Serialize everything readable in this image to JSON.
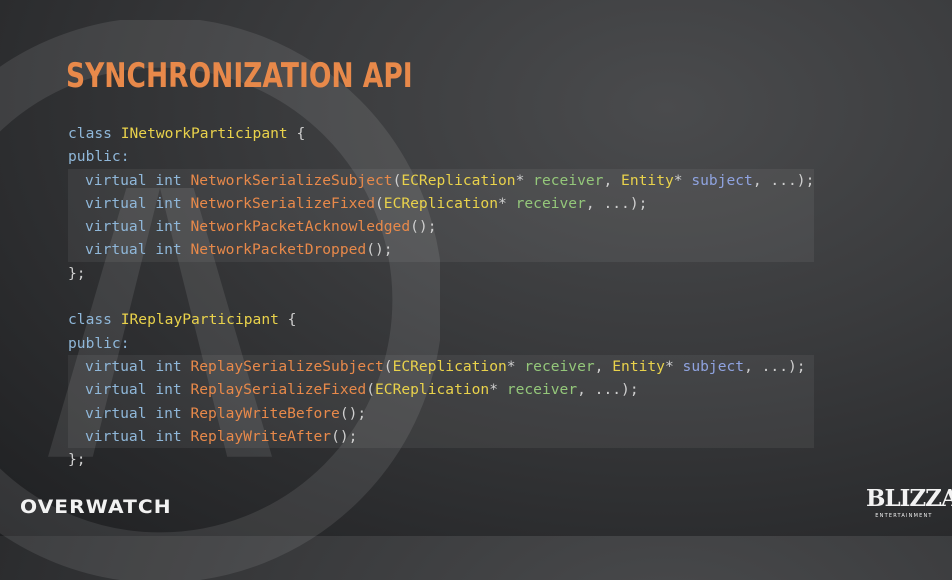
{
  "title": "SYNCHRONIZATION API",
  "code": {
    "network": {
      "class_kw": "class",
      "class_name": "INetworkParticipant",
      "open_brace": " {",
      "public": "public:",
      "lines": [
        {
          "kw": "virtual",
          "type": "int",
          "fn": "NetworkSerializeSubject",
          "a1": "ECReplication",
          "p1": "receiver",
          "a2": "Entity",
          "p2": "subject"
        },
        {
          "kw": "virtual",
          "type": "int",
          "fn": "NetworkSerializeFixed",
          "a1": "ECReplication",
          "p1": "receiver"
        },
        {
          "kw": "virtual",
          "type": "int",
          "fn": "NetworkPacketAcknowledged"
        },
        {
          "kw": "virtual",
          "type": "int",
          "fn": "NetworkPacketDropped"
        }
      ],
      "close": "};"
    },
    "replay": {
      "class_kw": "class",
      "class_name": "IReplayParticipant",
      "open_brace": " {",
      "public": "public:",
      "lines": [
        {
          "kw": "virtual",
          "type": "int",
          "fn": "ReplaySerializeSubject",
          "a1": "ECReplication",
          "p1": "receiver",
          "a2": "Entity",
          "p2": "subject"
        },
        {
          "kw": "virtual",
          "type": "int",
          "fn": "ReplaySerializeFixed",
          "a1": "ECReplication",
          "p1": "receiver"
        },
        {
          "kw": "virtual",
          "type": "int",
          "fn": "ReplayWriteBefore"
        },
        {
          "kw": "virtual",
          "type": "int",
          "fn": "ReplayWriteAfter"
        }
      ],
      "close": "};"
    }
  },
  "footer": {
    "overwatch_logo": "OVERWATCH",
    "blizzard_logo": "BLIZZARD",
    "blizzard_sub": "ENTERTAINMENT"
  },
  "colors": {
    "title": "#e8894a",
    "keyword": "#8fb7d9",
    "class_name": "#e9d24b",
    "function": "#e8894a",
    "param": "#94c77a"
  }
}
